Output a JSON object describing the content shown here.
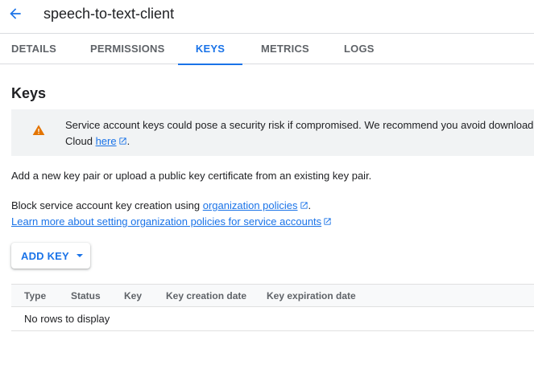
{
  "header": {
    "title": "speech-to-text-client",
    "back_icon": "arrow-back-icon"
  },
  "tabs": [
    {
      "label": "DETAILS",
      "active": false
    },
    {
      "label": "PERMISSIONS",
      "active": false
    },
    {
      "label": "KEYS",
      "active": true
    },
    {
      "label": "METRICS",
      "active": false
    },
    {
      "label": "LOGS",
      "active": false
    }
  ],
  "section": {
    "title": "Keys"
  },
  "warning": {
    "icon": "warning-triangle-icon",
    "line1": "Service account keys could pose a security risk if compromised. We recommend you avoid download",
    "line2_prefix": "Cloud ",
    "line2_link": "here",
    "line2_suffix": "."
  },
  "intro": "Add a new key pair or upload a public key certificate from an existing key pair.",
  "policy": {
    "prefix": "Block service account key creation using ",
    "link": "organization policies",
    "suffix": ".",
    "learn_more": "Learn more about setting organization policies for service accounts"
  },
  "add_key": {
    "label": "ADD KEY"
  },
  "table": {
    "columns": [
      "Type",
      "Status",
      "Key",
      "Key creation date",
      "Key expiration date"
    ],
    "empty_text": "No rows to display"
  },
  "colors": {
    "accent": "#1a73e8",
    "warning": "#e37400",
    "text": "#202124",
    "muted": "#5f6368"
  }
}
